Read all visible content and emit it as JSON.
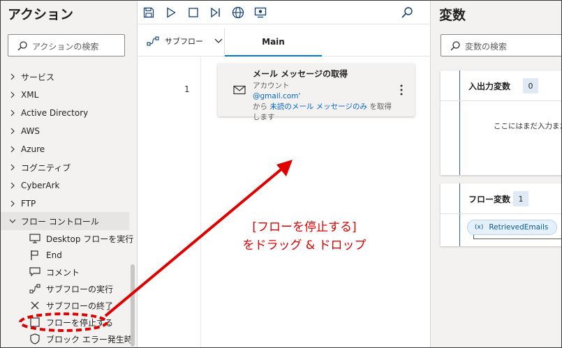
{
  "left_panel": {
    "title": "アクション",
    "search_placeholder": "アクションの検索",
    "categories": [
      {
        "label": "サービス"
      },
      {
        "label": "XML"
      },
      {
        "label": "Active Directory"
      },
      {
        "label": "AWS"
      },
      {
        "label": "Azure"
      },
      {
        "label": "コグニティブ"
      },
      {
        "label": "CyberArk"
      },
      {
        "label": "FTP"
      }
    ],
    "open_category": {
      "label": "フロー コントロール"
    },
    "actions": [
      {
        "label": "Desktop フローを実行",
        "icon": "desktop-flow-icon"
      },
      {
        "label": "End",
        "icon": "end-flag-icon"
      },
      {
        "label": "コメント",
        "icon": "comment-icon"
      },
      {
        "label": "サブフローの実行",
        "icon": "run-subflow-icon"
      },
      {
        "label": "サブフローの終了",
        "icon": "close-icon"
      },
      {
        "label": "フローを停止する",
        "icon": "stop-square-icon"
      },
      {
        "label": "ブロック エラー発生時",
        "icon": "shield-icon"
      }
    ]
  },
  "toolbar": {
    "icons": [
      "save-icon",
      "play-icon",
      "stop-icon",
      "step-icon",
      "web-recorder-icon",
      "desktop-recorder-icon",
      "search-icon"
    ]
  },
  "tabs": {
    "subflow_label": "サブフロー",
    "main_label": "Main"
  },
  "flow": {
    "steps": [
      {
        "line": "1",
        "title": "メール メッセージの取得",
        "desc_prefix": "アカウント",
        "desc_account": "@gmail.com'",
        "desc_mid": "から",
        "desc_link": "未読のメール メッセージのみ",
        "desc_suffix": "を取得します",
        "icon": "mail-icon"
      }
    ]
  },
  "right_panel": {
    "title": "変数",
    "search_placeholder": "変数の検索",
    "io_section": {
      "title": "入出力変数",
      "count": "0",
      "empty_text": "ここにはまだ入力また"
    },
    "flow_section": {
      "title": "フロー変数",
      "count": "1",
      "variables": [
        {
          "name": "RetrievedEmails",
          "icon": "(x)"
        }
      ]
    }
  },
  "annotation": {
    "line1": "[フローを停止する]",
    "line2": "をドラッグ & ドロップ",
    "color": "#e00000"
  },
  "colors": {
    "accent": "#0078d4",
    "panel": "#f3f2f1"
  }
}
